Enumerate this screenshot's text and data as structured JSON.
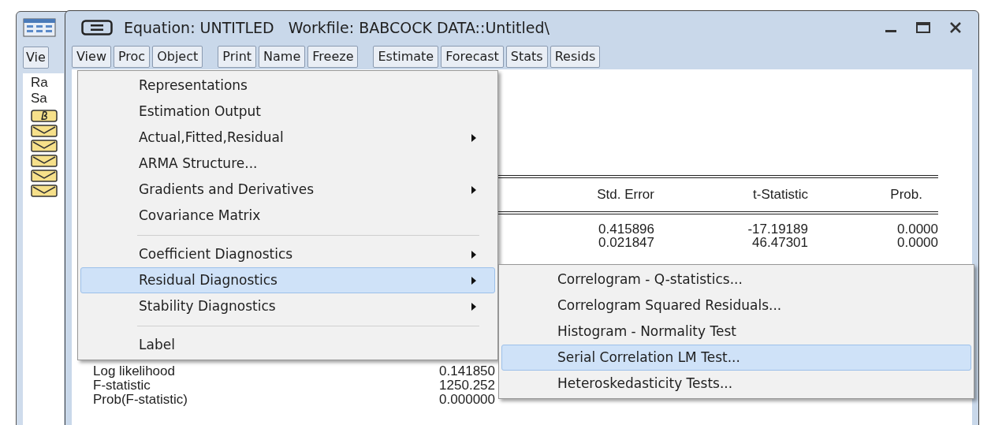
{
  "back_window": {
    "toolbar": [
      "Vie"
    ],
    "labels": [
      "Ra",
      "Sa"
    ],
    "object_icons": [
      {
        "kind": "coefficient"
      },
      {
        "kind": "series"
      },
      {
        "kind": "series"
      },
      {
        "kind": "series"
      },
      {
        "kind": "series"
      },
      {
        "kind": "series"
      }
    ]
  },
  "window": {
    "title": "Equation: UNTITLED",
    "workfile": "Workfile: BABCOCK DATA::Untitled\\"
  },
  "toolbar_groups": [
    [
      "View",
      "Proc",
      "Object"
    ],
    [
      "Print",
      "Name",
      "Freeze"
    ],
    [
      "Estimate",
      "Forecast",
      "Stats",
      "Resids"
    ]
  ],
  "table": {
    "columns": [
      "Std. Error",
      "t-Statistic",
      "Prob."
    ],
    "rows": [
      [
        "0.415896",
        "-17.19189",
        "0.0000"
      ],
      [
        "0.021847",
        "46.47301",
        "0.0000"
      ]
    ]
  },
  "stats": [
    {
      "label": "Log likelihood",
      "value": "0.141850"
    },
    {
      "label": "F-statistic",
      "value": "1250.252"
    },
    {
      "label": "Prob(F-statistic)",
      "value": "0.000000"
    }
  ],
  "view_menu": [
    {
      "kind": "item",
      "label": "Representations",
      "submenu": false,
      "selected": false
    },
    {
      "kind": "item",
      "label": "Estimation Output",
      "submenu": false,
      "selected": false
    },
    {
      "kind": "item",
      "label": "Actual,Fitted,Residual",
      "submenu": true,
      "selected": false
    },
    {
      "kind": "item",
      "label": "ARMA Structure...",
      "submenu": false,
      "selected": false
    },
    {
      "kind": "item",
      "label": "Gradients and Derivatives",
      "submenu": true,
      "selected": false
    },
    {
      "kind": "item",
      "label": "Covariance Matrix",
      "submenu": false,
      "selected": false
    },
    {
      "kind": "separator"
    },
    {
      "kind": "item",
      "label": "Coefficient Diagnostics",
      "submenu": true,
      "selected": false
    },
    {
      "kind": "item",
      "label": "Residual Diagnostics",
      "submenu": true,
      "selected": true
    },
    {
      "kind": "item",
      "label": "Stability Diagnostics",
      "submenu": true,
      "selected": false
    },
    {
      "kind": "separator"
    },
    {
      "kind": "item",
      "label": "Label",
      "submenu": false,
      "selected": false
    }
  ],
  "residual_submenu": [
    {
      "label": "Correlogram - Q-statistics...",
      "selected": false
    },
    {
      "label": "Correlogram Squared Residuals...",
      "selected": false
    },
    {
      "label": "Histogram - Normality Test",
      "selected": false
    },
    {
      "label": "Serial Correlation LM Test...",
      "selected": true
    },
    {
      "label": "Heteroskedasticity Tests...",
      "selected": false
    }
  ]
}
